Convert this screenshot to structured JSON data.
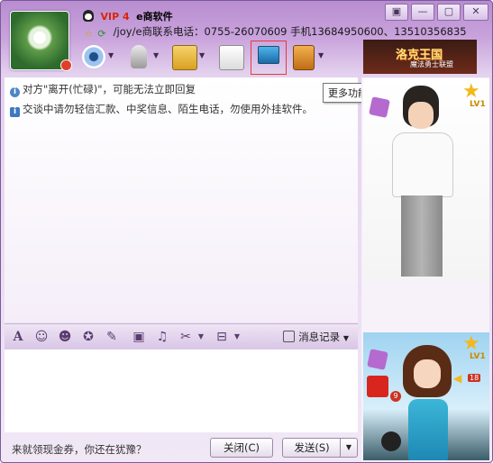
{
  "window": {
    "controls": [
      "▣",
      "—",
      "▢",
      "✕"
    ]
  },
  "contact": {
    "vip_label": "VIP 4",
    "nickname": "e商软件",
    "signature": "/joy/e商联系电话：0755-26070609  手机13684950600、13510356835"
  },
  "toolbar": {
    "tooltip": "更多功能",
    "banner_title": "洛克王国",
    "banner_sub": "魔法勇士联盟"
  },
  "chat": {
    "messages": [
      "对方\"离开(忙碌)\"，可能无法立即回复",
      "交谈中请勿轻信汇款、中奖信息、陌生电话，勿使用外挂软件。"
    ]
  },
  "format_bar": {
    "history_label": "消息记录"
  },
  "footer": {
    "promo_text": "来就领现金券，你还在犹豫？",
    "close_label": "关闭(C)",
    "send_label": "发送(S)"
  },
  "sidebar": {
    "level_1": "LV1",
    "level_2": "LV1",
    "badge_1": "9",
    "badge_2": "18"
  },
  "colors": {
    "accent_purple": "#b88dd0",
    "vip_red": "#d8260a",
    "highlight_red": "#e03c3c"
  }
}
